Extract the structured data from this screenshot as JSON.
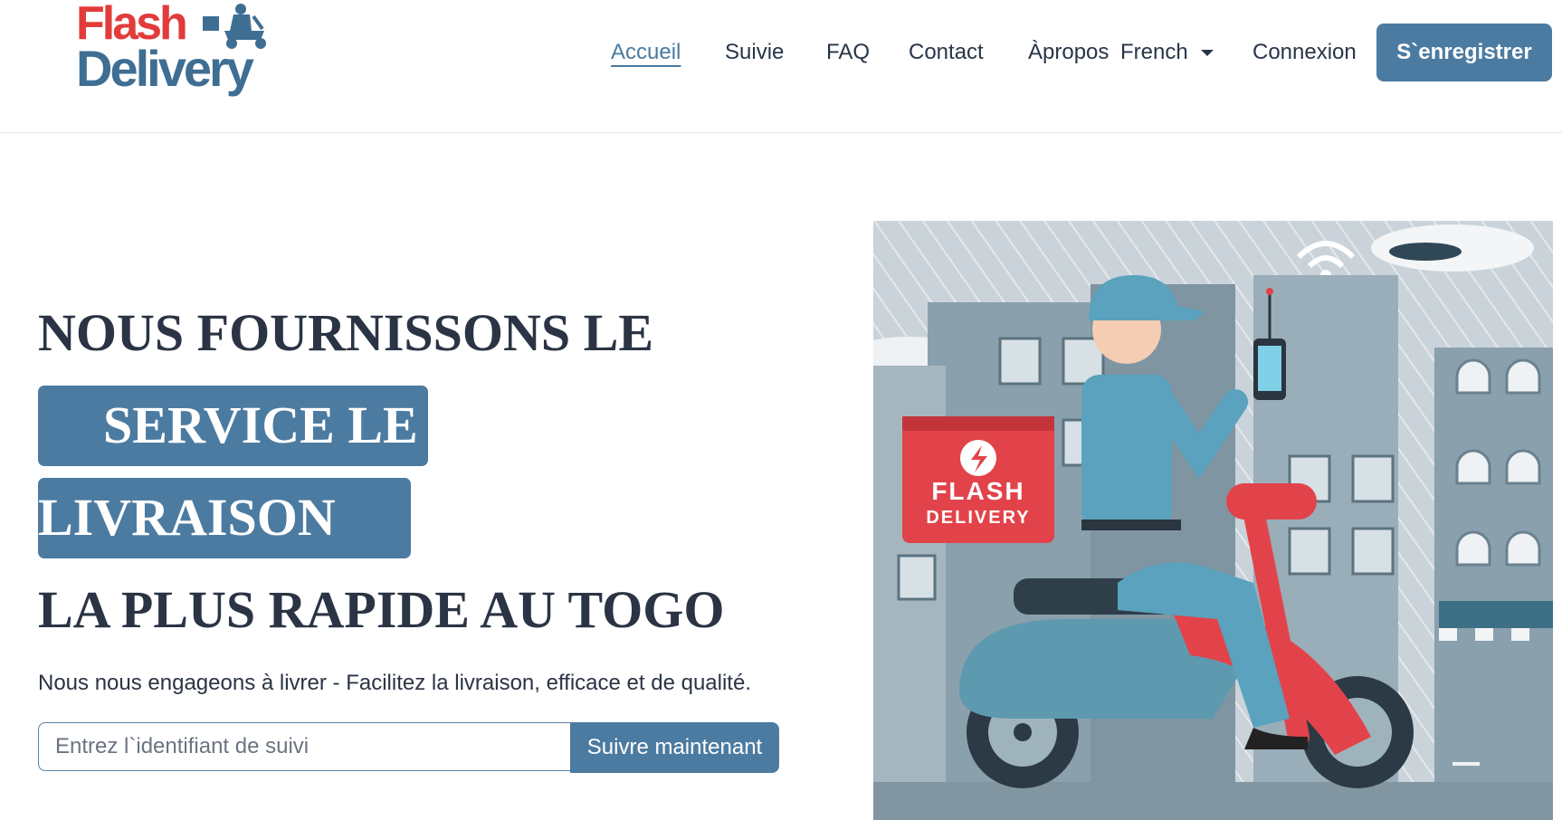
{
  "brand": {
    "logo_line1": "Flash",
    "logo_line2": "Delivery",
    "primary_color": "#4c7ba1",
    "accent_color": "#e23b3b"
  },
  "nav": {
    "items": [
      {
        "label": "Accueil",
        "active": true
      },
      {
        "label": "Suivie"
      },
      {
        "label": "FAQ"
      },
      {
        "label": "Contact"
      },
      {
        "label": "Àpropos"
      },
      {
        "label": "French"
      },
      {
        "label": "Connexion"
      }
    ],
    "register_label": "S`enregistrer"
  },
  "hero": {
    "line1": "NOUS FOURNISSONS LE",
    "highlight1": "SERVICE LE",
    "highlight2": "LIVRAISON",
    "line4": "LA PLUS RAPIDE AU TOGO",
    "subtitle": "Nous nous engageons à livrer - Facilitez la livraison, efficace et de qualité."
  },
  "tracking": {
    "placeholder": "Entrez l`identifiant de suivi",
    "button_label": "Suivre maintenant"
  },
  "illustration": {
    "box_line1": "FLASH",
    "box_line2": "DELIVERY"
  }
}
